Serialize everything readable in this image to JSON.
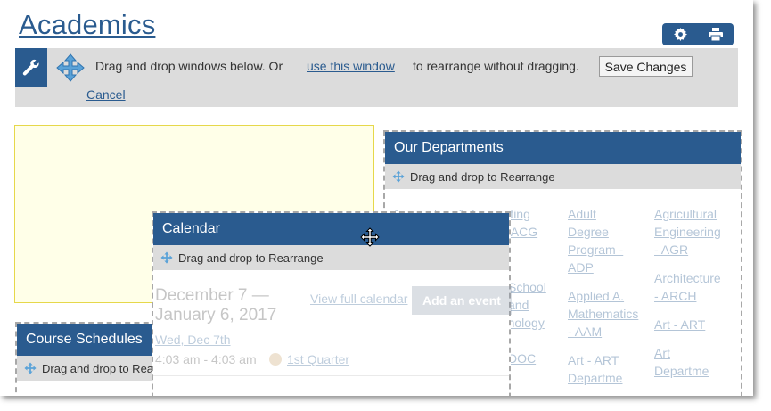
{
  "page": {
    "title": "Academics"
  },
  "toolbar": {
    "settings_icon": "gear-icon",
    "print_icon": "printer-icon",
    "accent": "#2a5b8f"
  },
  "editbar": {
    "wrench_icon": "wrench-icon",
    "move_icon": "move-arrows-icon",
    "message_before": "Drag and drop windows below. Or",
    "link_label": "use this window",
    "message_after": "to rearrange without dragging.",
    "save_label": "Save Changes",
    "cancel_label": "Cancel"
  },
  "windows": {
    "grip_label": "Drag and drop to Rearrange",
    "departments": {
      "title": "Our Departments",
      "col1": [
        "Accounting & Accounting",
        "- ACG",
        "",
        "School",
        "and",
        "Technology -",
        "DOC"
      ],
      "col2": [
        "Adult Degree Program - ADP",
        "Applied A. Mathematics - AAM",
        "Art - ART Departme"
      ],
      "col3": [
        "Agricultural Engineering - AGR",
        "Architecture - ARCH",
        "Art - ART",
        "Art Departme"
      ]
    },
    "course": {
      "title": "Course Schedules",
      "grip_label": "Drag and drop to Rea"
    },
    "calendar": {
      "title": "Calendar",
      "date_range": "December 7 — January 6, 2017",
      "full_link": "View full calendar",
      "add_button": "Add an event",
      "day": "Wed, Dec 7th",
      "time": "4:03 am - 4:03 am",
      "event": "1st Quarter"
    }
  }
}
